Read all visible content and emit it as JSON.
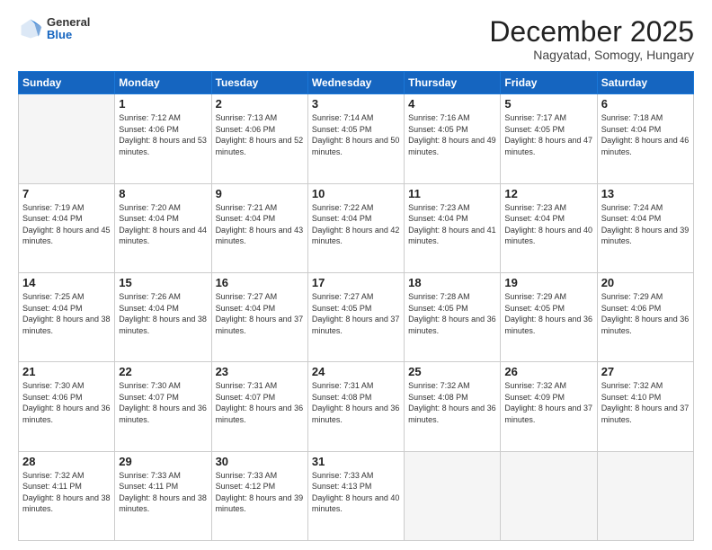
{
  "header": {
    "logo_general": "General",
    "logo_blue": "Blue",
    "title": "December 2025",
    "subtitle": "Nagyatad, Somogy, Hungary"
  },
  "calendar": {
    "days_of_week": [
      "Sunday",
      "Monday",
      "Tuesday",
      "Wednesday",
      "Thursday",
      "Friday",
      "Saturday"
    ],
    "weeks": [
      [
        {
          "day": "",
          "sunrise": "",
          "sunset": "",
          "daylight": ""
        },
        {
          "day": "1",
          "sunrise": "7:12 AM",
          "sunset": "4:06 PM",
          "daylight": "8 hours and 53 minutes."
        },
        {
          "day": "2",
          "sunrise": "7:13 AM",
          "sunset": "4:06 PM",
          "daylight": "8 hours and 52 minutes."
        },
        {
          "day": "3",
          "sunrise": "7:14 AM",
          "sunset": "4:05 PM",
          "daylight": "8 hours and 50 minutes."
        },
        {
          "day": "4",
          "sunrise": "7:16 AM",
          "sunset": "4:05 PM",
          "daylight": "8 hours and 49 minutes."
        },
        {
          "day": "5",
          "sunrise": "7:17 AM",
          "sunset": "4:05 PM",
          "daylight": "8 hours and 47 minutes."
        },
        {
          "day": "6",
          "sunrise": "7:18 AM",
          "sunset": "4:04 PM",
          "daylight": "8 hours and 46 minutes."
        }
      ],
      [
        {
          "day": "7",
          "sunrise": "7:19 AM",
          "sunset": "4:04 PM",
          "daylight": "8 hours and 45 minutes."
        },
        {
          "day": "8",
          "sunrise": "7:20 AM",
          "sunset": "4:04 PM",
          "daylight": "8 hours and 44 minutes."
        },
        {
          "day": "9",
          "sunrise": "7:21 AM",
          "sunset": "4:04 PM",
          "daylight": "8 hours and 43 minutes."
        },
        {
          "day": "10",
          "sunrise": "7:22 AM",
          "sunset": "4:04 PM",
          "daylight": "8 hours and 42 minutes."
        },
        {
          "day": "11",
          "sunrise": "7:23 AM",
          "sunset": "4:04 PM",
          "daylight": "8 hours and 41 minutes."
        },
        {
          "day": "12",
          "sunrise": "7:23 AM",
          "sunset": "4:04 PM",
          "daylight": "8 hours and 40 minutes."
        },
        {
          "day": "13",
          "sunrise": "7:24 AM",
          "sunset": "4:04 PM",
          "daylight": "8 hours and 39 minutes."
        }
      ],
      [
        {
          "day": "14",
          "sunrise": "7:25 AM",
          "sunset": "4:04 PM",
          "daylight": "8 hours and 38 minutes."
        },
        {
          "day": "15",
          "sunrise": "7:26 AM",
          "sunset": "4:04 PM",
          "daylight": "8 hours and 38 minutes."
        },
        {
          "day": "16",
          "sunrise": "7:27 AM",
          "sunset": "4:04 PM",
          "daylight": "8 hours and 37 minutes."
        },
        {
          "day": "17",
          "sunrise": "7:27 AM",
          "sunset": "4:05 PM",
          "daylight": "8 hours and 37 minutes."
        },
        {
          "day": "18",
          "sunrise": "7:28 AM",
          "sunset": "4:05 PM",
          "daylight": "8 hours and 36 minutes."
        },
        {
          "day": "19",
          "sunrise": "7:29 AM",
          "sunset": "4:05 PM",
          "daylight": "8 hours and 36 minutes."
        },
        {
          "day": "20",
          "sunrise": "7:29 AM",
          "sunset": "4:06 PM",
          "daylight": "8 hours and 36 minutes."
        }
      ],
      [
        {
          "day": "21",
          "sunrise": "7:30 AM",
          "sunset": "4:06 PM",
          "daylight": "8 hours and 36 minutes."
        },
        {
          "day": "22",
          "sunrise": "7:30 AM",
          "sunset": "4:07 PM",
          "daylight": "8 hours and 36 minutes."
        },
        {
          "day": "23",
          "sunrise": "7:31 AM",
          "sunset": "4:07 PM",
          "daylight": "8 hours and 36 minutes."
        },
        {
          "day": "24",
          "sunrise": "7:31 AM",
          "sunset": "4:08 PM",
          "daylight": "8 hours and 36 minutes."
        },
        {
          "day": "25",
          "sunrise": "7:32 AM",
          "sunset": "4:08 PM",
          "daylight": "8 hours and 36 minutes."
        },
        {
          "day": "26",
          "sunrise": "7:32 AM",
          "sunset": "4:09 PM",
          "daylight": "8 hours and 37 minutes."
        },
        {
          "day": "27",
          "sunrise": "7:32 AM",
          "sunset": "4:10 PM",
          "daylight": "8 hours and 37 minutes."
        }
      ],
      [
        {
          "day": "28",
          "sunrise": "7:32 AM",
          "sunset": "4:11 PM",
          "daylight": "8 hours and 38 minutes."
        },
        {
          "day": "29",
          "sunrise": "7:33 AM",
          "sunset": "4:11 PM",
          "daylight": "8 hours and 38 minutes."
        },
        {
          "day": "30",
          "sunrise": "7:33 AM",
          "sunset": "4:12 PM",
          "daylight": "8 hours and 39 minutes."
        },
        {
          "day": "31",
          "sunrise": "7:33 AM",
          "sunset": "4:13 PM",
          "daylight": "8 hours and 40 minutes."
        },
        {
          "day": "",
          "sunrise": "",
          "sunset": "",
          "daylight": ""
        },
        {
          "day": "",
          "sunrise": "",
          "sunset": "",
          "daylight": ""
        },
        {
          "day": "",
          "sunrise": "",
          "sunset": "",
          "daylight": ""
        }
      ]
    ]
  }
}
